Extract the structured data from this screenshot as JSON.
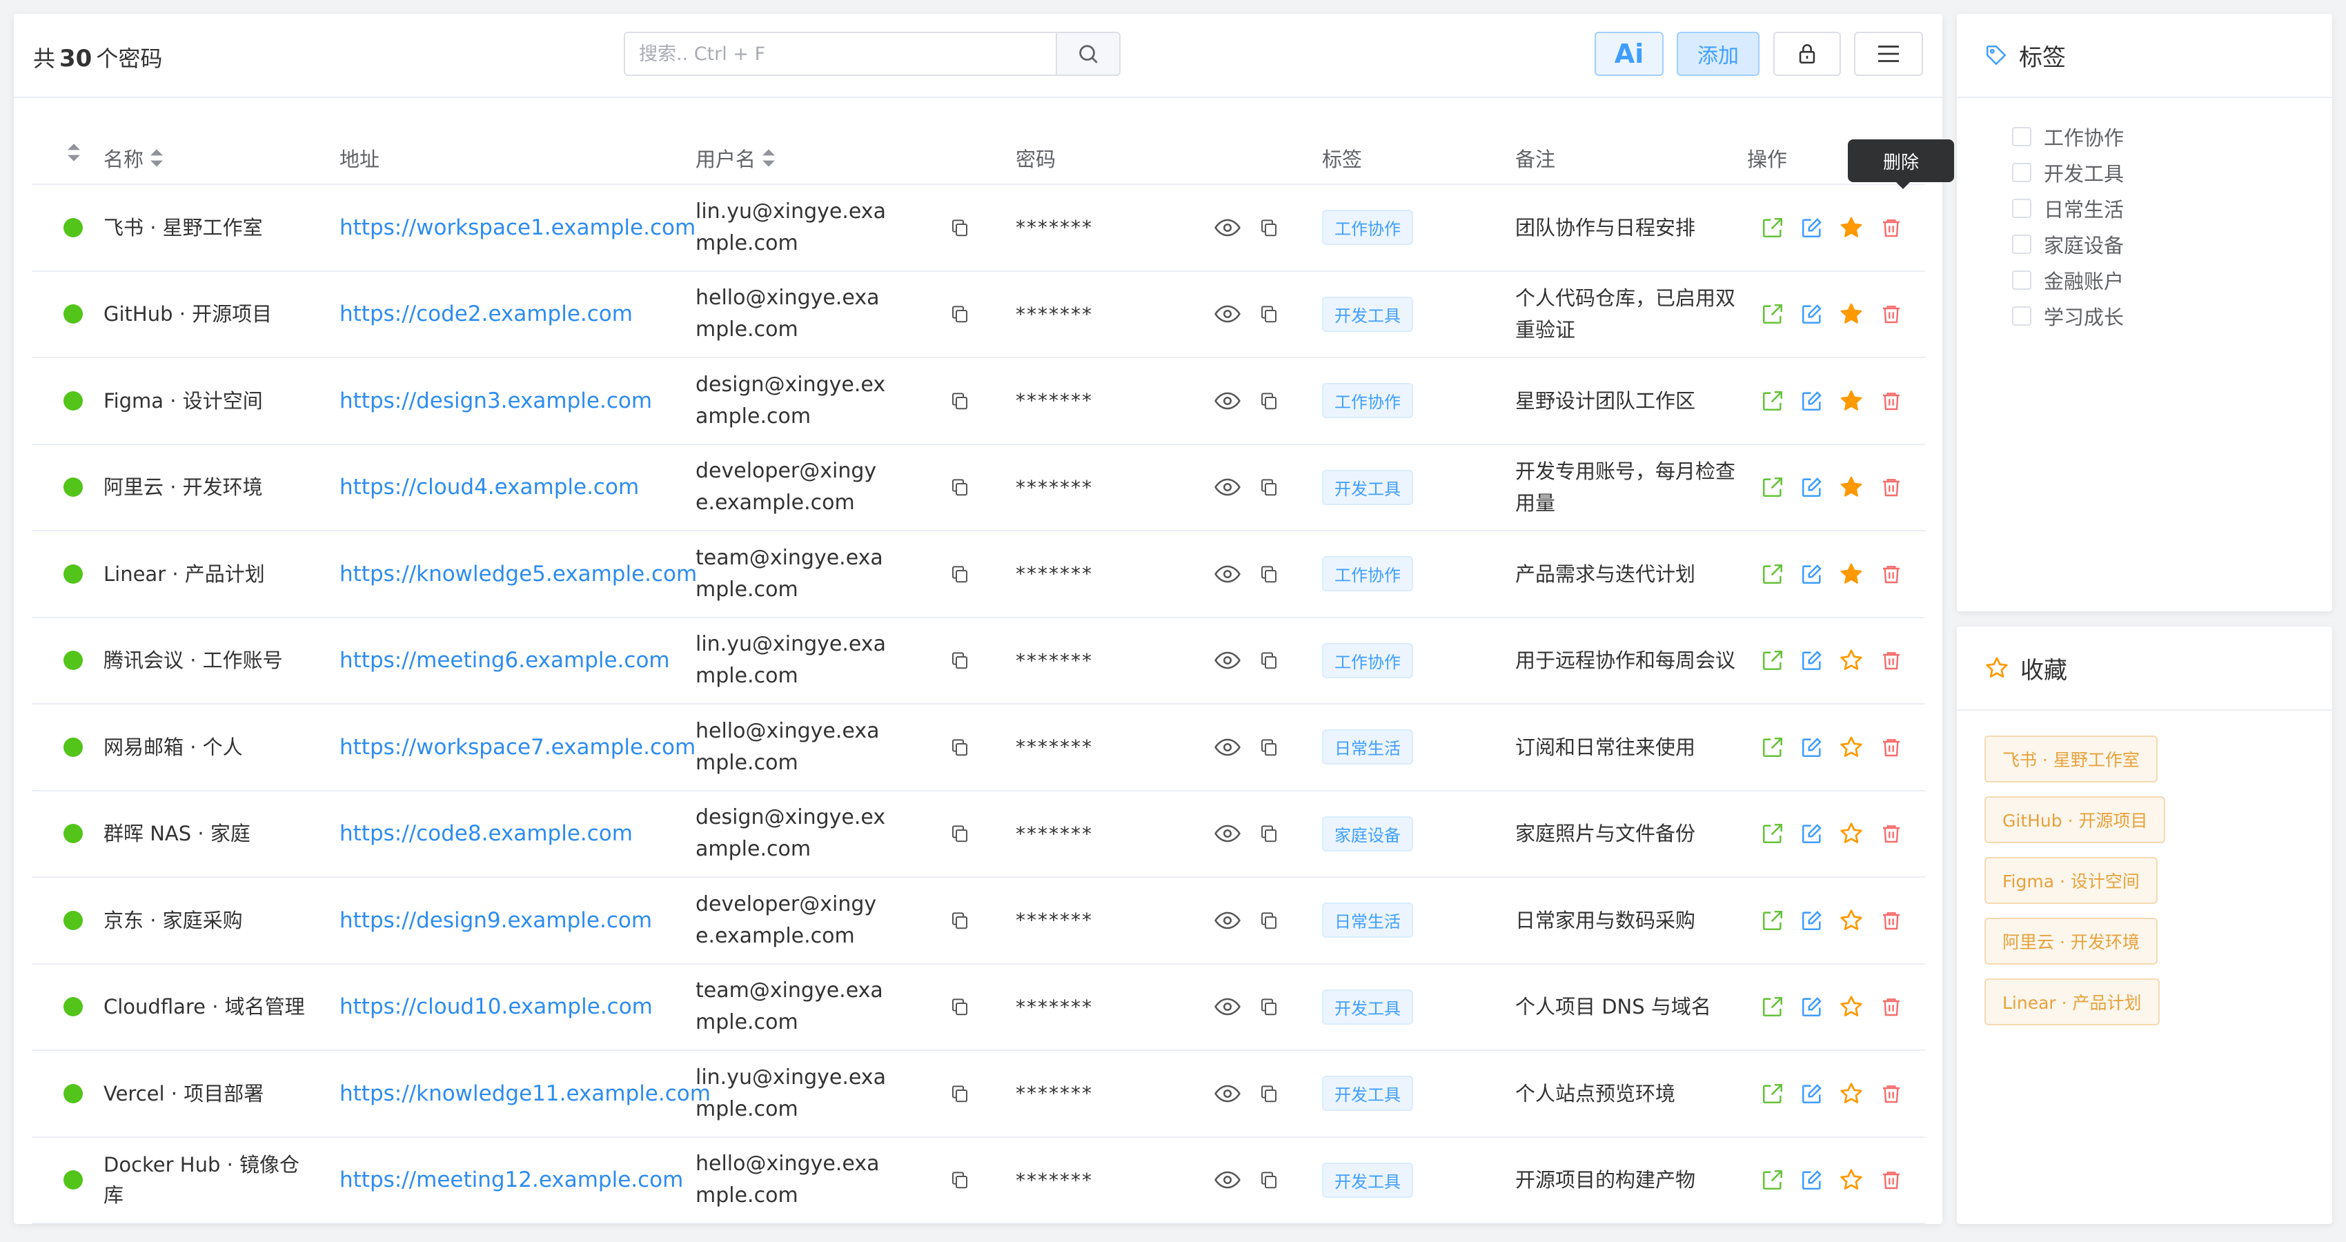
{
  "toolbar": {
    "count_prefix": "共",
    "count": "30",
    "count_suffix": "个密码",
    "search_placeholder": "搜索.. Ctrl + F",
    "ai_label": "Ai",
    "add_label": "添加"
  },
  "table": {
    "headers": {
      "name": "名称",
      "url": "地址",
      "username": "用户名",
      "password": "密码",
      "tag": "标签",
      "note": "备注",
      "actions": "操作"
    },
    "rows": [
      {
        "name": "飞书 · 星野工作室",
        "url": "https://workspace1.example.com",
        "username": "lin.yu@xingye.example.com",
        "password": "*******",
        "tag": "工作协作",
        "note": "团队协作与日程安排",
        "favorite": true
      },
      {
        "name": "GitHub · 开源项目",
        "url": "https://code2.example.com",
        "username": "hello@xingye.example.com",
        "password": "*******",
        "tag": "开发工具",
        "note": "个人代码仓库，已启用双重验证",
        "favorite": true
      },
      {
        "name": "Figma · 设计空间",
        "url": "https://design3.example.com",
        "username": "design@xingye.example.com",
        "password": "*******",
        "tag": "工作协作",
        "note": "星野设计团队工作区",
        "favorite": true
      },
      {
        "name": "阿里云 · 开发环境",
        "url": "https://cloud4.example.com",
        "username": "developer@xingye.example.com",
        "password": "*******",
        "tag": "开发工具",
        "note": "开发专用账号，每月检查用量",
        "favorite": true
      },
      {
        "name": "Linear · 产品计划",
        "url": "https://knowledge5.example.com",
        "username": "team@xingye.example.com",
        "password": "*******",
        "tag": "工作协作",
        "note": "产品需求与迭代计划",
        "favorite": true
      },
      {
        "name": "腾讯会议 · 工作账号",
        "url": "https://meeting6.example.com",
        "username": "lin.yu@xingye.example.com",
        "password": "*******",
        "tag": "工作协作",
        "note": "用于远程协作和每周会议",
        "favorite": false
      },
      {
        "name": "网易邮箱 · 个人",
        "url": "https://workspace7.example.com",
        "username": "hello@xingye.example.com",
        "password": "*******",
        "tag": "日常生活",
        "note": "订阅和日常往来使用",
        "favorite": false
      },
      {
        "name": "群晖 NAS · 家庭",
        "url": "https://code8.example.com",
        "username": "design@xingye.example.com",
        "password": "*******",
        "tag": "家庭设备",
        "note": "家庭照片与文件备份",
        "favorite": false
      },
      {
        "name": "京东 · 家庭采购",
        "url": "https://design9.example.com",
        "username": "developer@xingye.example.com",
        "password": "*******",
        "tag": "日常生活",
        "note": "日常家用与数码采购",
        "favorite": false
      },
      {
        "name": "Cloudflare · 域名管理",
        "url": "https://cloud10.example.com",
        "username": "team@xingye.example.com",
        "password": "*******",
        "tag": "开发工具",
        "note": "个人项目 DNS 与域名",
        "favorite": false
      },
      {
        "name": "Vercel · 项目部署",
        "url": "https://knowledge11.example.com",
        "username": "lin.yu@xingye.example.com",
        "password": "*******",
        "tag": "开发工具",
        "note": "个人站点预览环境",
        "favorite": false
      },
      {
        "name": "Docker Hub · 镜像仓库",
        "url": "https://meeting12.example.com",
        "username": "hello@xingye.example.com",
        "password": "*******",
        "tag": "开发工具",
        "note": "开源项目的构建产物",
        "favorite": false
      }
    ]
  },
  "tooltip": {
    "text": "删除"
  },
  "tags_panel": {
    "title": "标签",
    "items": [
      "工作协作",
      "开发工具",
      "日常生活",
      "家庭设备",
      "金融账户",
      "学习成长"
    ]
  },
  "favorites_panel": {
    "title": "收藏",
    "items": [
      "飞书 · 星野工作室",
      "GitHub · 开源项目",
      "Figma · 设计空间",
      "阿里云 · 开发环境",
      "Linear · 产品计划"
    ]
  },
  "colors": {
    "accent": "#409eff",
    "status_green": "#52c41a",
    "star": "#ff9900",
    "delete": "#f56c6c",
    "share": "#67c23a"
  }
}
